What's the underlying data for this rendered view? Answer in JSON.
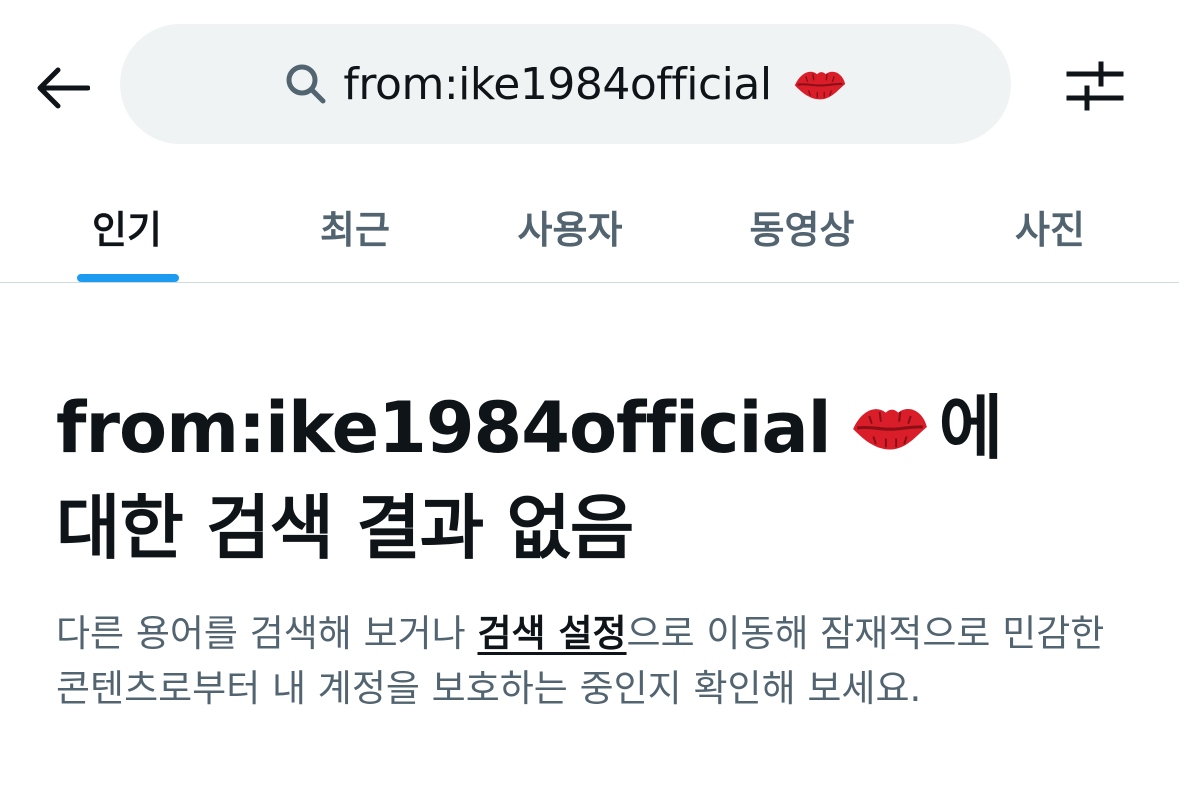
{
  "search": {
    "query": "from:ike1984official",
    "emoji": "kiss-mark-lips"
  },
  "icons": {
    "back": "arrow-left-icon",
    "search": "search-icon",
    "filter": "filter-sliders-icon"
  },
  "tabs": [
    {
      "label": "인기",
      "active": true
    },
    {
      "label": "최근",
      "active": false
    },
    {
      "label": "사용자",
      "active": false
    },
    {
      "label": "동영상",
      "active": false
    },
    {
      "label": "사진",
      "active": false
    }
  ],
  "empty_state": {
    "title_query": "from:ike1984official",
    "title_suffix_1": "에",
    "title_suffix_2": "대한 검색 결과 없음",
    "desc_before": "다른 용어를 검색해 보거나 ",
    "desc_link": "검색 설정",
    "desc_after": "으로 이동해 잠재적으로 민감한 콘텐츠로부터 내 계정을 보호하는 중인지 확인해 보세요."
  },
  "colors": {
    "accent": "#1d9bf0",
    "pill_bg": "#eff3f4",
    "text_primary": "#0f1419",
    "text_secondary": "#536471",
    "divider": "#cfd9de",
    "lips": "#d91e2a"
  }
}
